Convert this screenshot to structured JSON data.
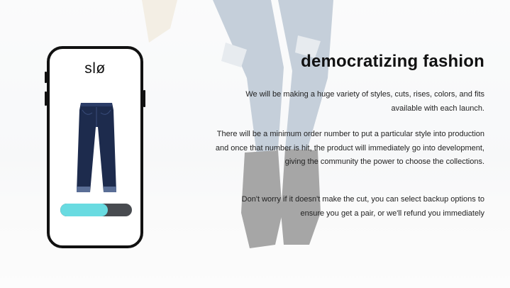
{
  "slide": {
    "brand": "slø",
    "headline": "democratizing fashion",
    "paragraphs": [
      "We will be making a huge variety of styles, cuts, rises, colors, and fits available with each launch.",
      "There will be a minimum order number to put a particular style into production and once that number is hit, the product will immediately go into development, giving the community the power to choose the collections.",
      "Don't worry if it doesn't make the cut, you can select backup options to ensure you get a pair, or we'll refund you immediately"
    ]
  },
  "progress": {
    "fraction": 0.66,
    "fill_color": "#69dbe1",
    "track_color": "#484b50"
  },
  "icons": {
    "product": "jeans-icon"
  },
  "colors": {
    "text": "#111111",
    "denim": "#1d2b4d"
  }
}
